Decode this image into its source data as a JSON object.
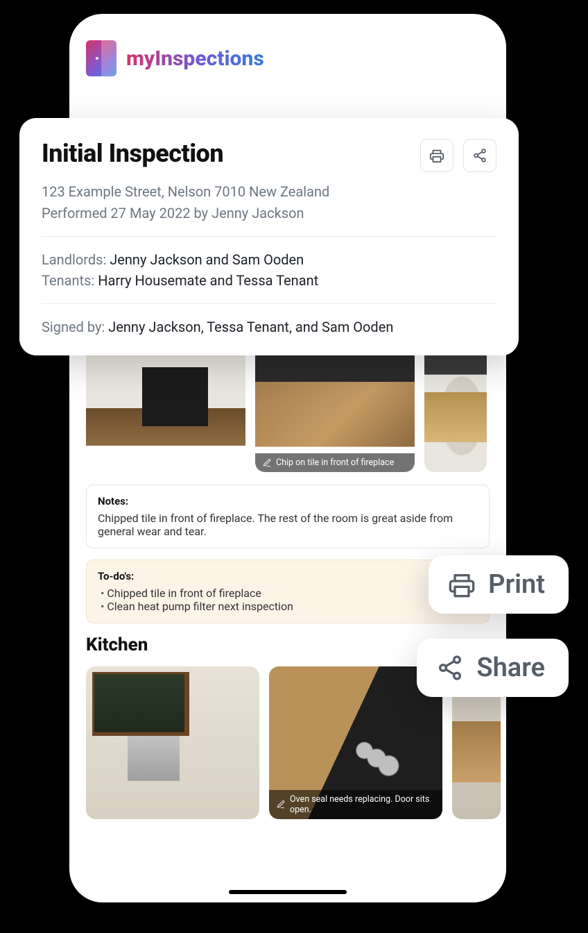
{
  "brand": {
    "name": "myInspections"
  },
  "inspection": {
    "title": "Initial Inspection",
    "address": "123 Example Street, Nelson 7010 New Zealand",
    "performed": "Performed 27 May 2022 by Jenny Jackson",
    "landlords_label": "Landlords: ",
    "landlords_value": "Jenny Jackson and Sam Ooden",
    "tenants_label": "Tenants: ",
    "tenants_value": "Harry Housemate and Tessa Tenant",
    "signed_label": "Signed by: ",
    "signed_value": "Jenny Jackson, Tessa Tenant, and Sam Ooden"
  },
  "living_room": {
    "photo2_caption": "Chip on tile in front of fireplace",
    "notes_heading": "Notes:",
    "notes_body": "Chipped tile in front of fireplace. The rest of the room is great aside from general wear and tear.",
    "todos_heading": "To-do's:",
    "todos": [
      "Chipped tile in front of fireplace",
      "Clean heat pump filter next inspection"
    ]
  },
  "kitchen": {
    "heading": "Kitchen",
    "photo2_caption": "Oven seal needs replacing. Door sits open."
  },
  "actions": {
    "print": "Print",
    "share": "Share"
  }
}
